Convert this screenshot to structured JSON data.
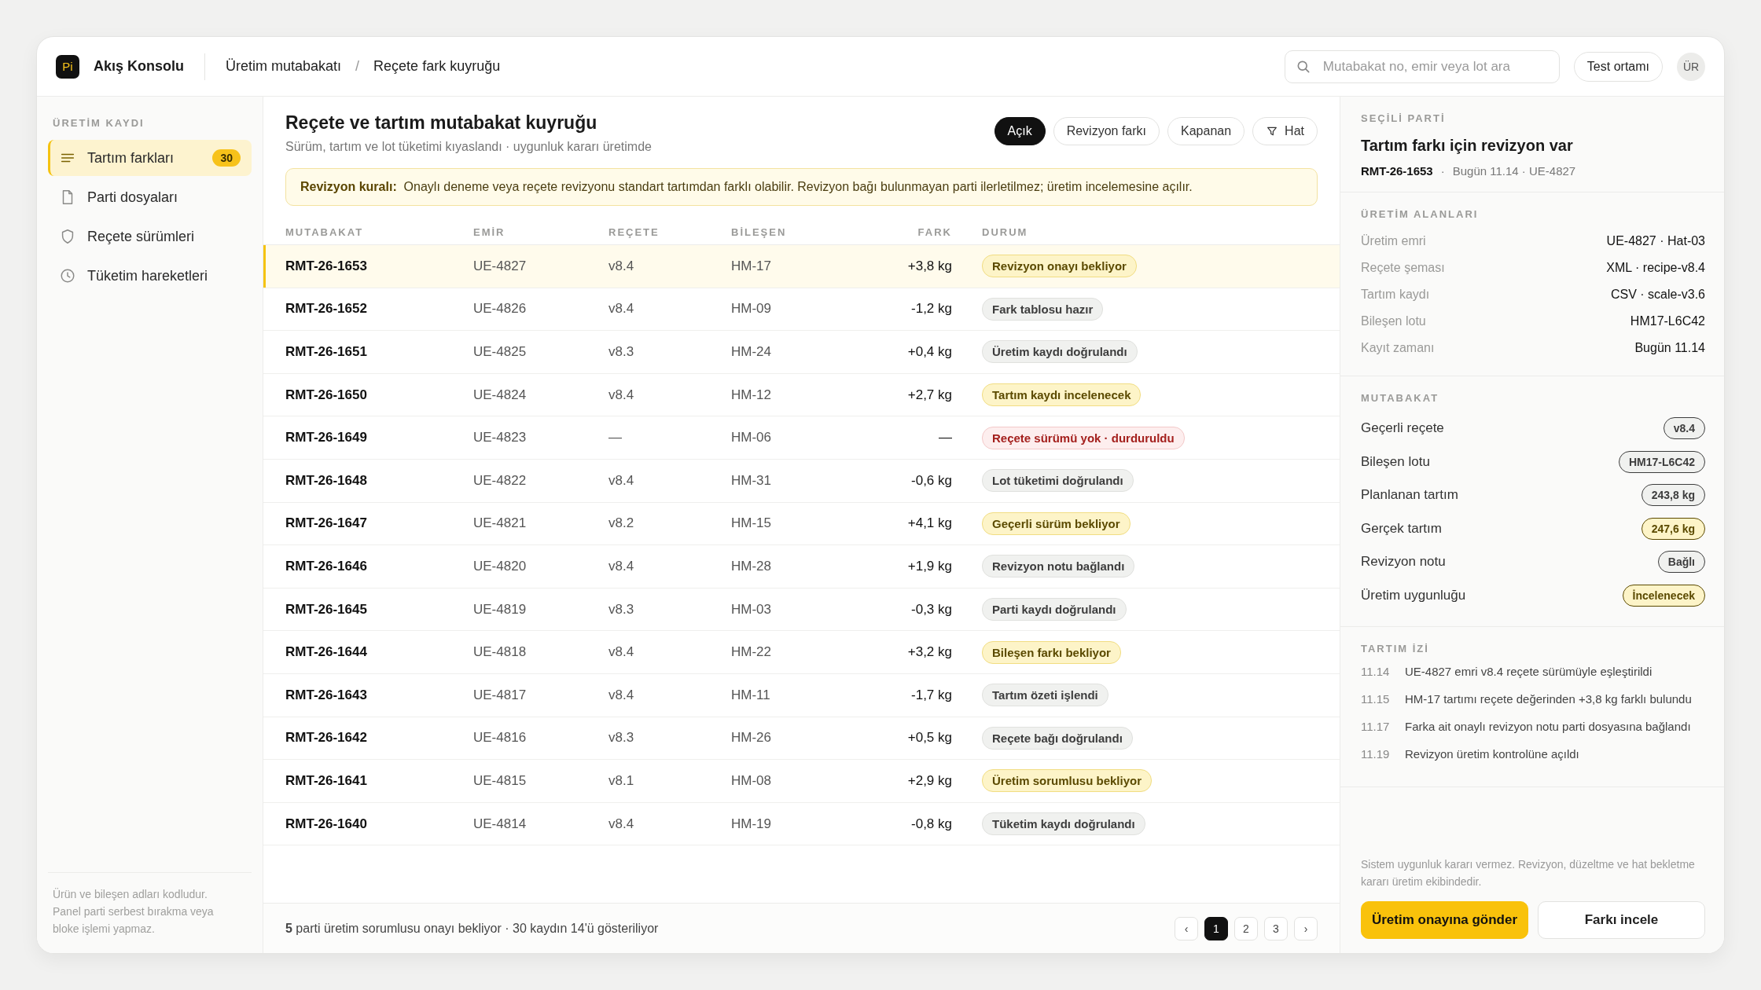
{
  "brand": {
    "logo": "Pi",
    "name": "Akış Konsolu"
  },
  "breadcrumb": {
    "items": [
      "Üretim mutabakatı",
      "Reçete fark kuyruğu"
    ],
    "separator": "/"
  },
  "search": {
    "placeholder": "Mutabakat no, emir veya lot ara"
  },
  "env_button": "Test ortamı",
  "avatar": "ÜR",
  "sidebar": {
    "heading": "ÜRETİM KAYDI",
    "items": [
      {
        "label": "Tartım farkları",
        "selected": true,
        "count": "30"
      },
      {
        "label": "Parti dosyaları",
        "selected": false
      },
      {
        "label": "Reçete sürümleri",
        "selected": false
      },
      {
        "label": "Tüketim hareketleri",
        "selected": false
      }
    ],
    "note": "Ürün ve bileşen adları kodludur. Panel parti serbest bırakma veya bloke işlemi yapmaz."
  },
  "main": {
    "title": "Reçete ve tartım mutabakat kuyruğu",
    "subtitle": "Sürüm, tartım ve lot tüketimi kıyaslandı · uygunluk kararı üretimde",
    "filters": [
      {
        "label": "Açık",
        "selected": true,
        "kind": "chip"
      },
      {
        "label": "Revizyon farkı",
        "selected": false,
        "kind": "chip"
      },
      {
        "label": "Kapanan",
        "selected": false,
        "kind": "chip"
      },
      {
        "label": "Hat",
        "selected": false,
        "kind": "filter"
      }
    ],
    "alert": "**Revizyon kuralı:**  Onaylı deneme veya reçete revizyonu standart tartımdan farklı olabilir. Revizyon bağı bulunmayan parti ilerletilmez; üretim incelemesine açılır."
  },
  "table": {
    "columns": [
      "MUTABAKAT",
      "EMİR",
      "REÇETE",
      "BİLEŞEN",
      "FARK",
      "DURUM"
    ],
    "rows": [
      {
        "id": "RMT-26-1653",
        "order": "UE-4827",
        "recipe": "v8.4",
        "component": "HM-17",
        "diff": "+3,8 kg",
        "status": "Revizyon onayı bekliyor",
        "kind": "warning",
        "selected": true
      },
      {
        "id": "RMT-26-1652",
        "order": "UE-4826",
        "recipe": "v8.4",
        "component": "HM-09",
        "diff": "-1,2 kg",
        "status": "Fark tablosu hazır",
        "kind": "neutral",
        "selected": false
      },
      {
        "id": "RMT-26-1651",
        "order": "UE-4825",
        "recipe": "v8.3",
        "component": "HM-24",
        "diff": "+0,4 kg",
        "status": "Üretim kaydı doğrulandı",
        "kind": "neutral",
        "selected": false
      },
      {
        "id": "RMT-26-1650",
        "order": "UE-4824",
        "recipe": "v8.4",
        "component": "HM-12",
        "diff": "+2,7 kg",
        "status": "Tartım kaydı incelenecek",
        "kind": "warning",
        "selected": false
      },
      {
        "id": "RMT-26-1649",
        "order": "UE-4823",
        "recipe": "—",
        "component": "HM-06",
        "diff": "—",
        "status": "Reçete sürümü yok · durduruldu",
        "kind": "error",
        "selected": false
      },
      {
        "id": "RMT-26-1648",
        "order": "UE-4822",
        "recipe": "v8.4",
        "component": "HM-31",
        "diff": "-0,6 kg",
        "status": "Lot tüketimi doğrulandı",
        "kind": "neutral",
        "selected": false
      },
      {
        "id": "RMT-26-1647",
        "order": "UE-4821",
        "recipe": "v8.2",
        "component": "HM-15",
        "diff": "+4,1 kg",
        "status": "Geçerli sürüm bekliyor",
        "kind": "warning",
        "selected": false
      },
      {
        "id": "RMT-26-1646",
        "order": "UE-4820",
        "recipe": "v8.4",
        "component": "HM-28",
        "diff": "+1,9 kg",
        "status": "Revizyon notu bağlandı",
        "kind": "neutral",
        "selected": false
      },
      {
        "id": "RMT-26-1645",
        "order": "UE-4819",
        "recipe": "v8.3",
        "component": "HM-03",
        "diff": "-0,3 kg",
        "status": "Parti kaydı doğrulandı",
        "kind": "neutral",
        "selected": false
      },
      {
        "id": "RMT-26-1644",
        "order": "UE-4818",
        "recipe": "v8.4",
        "component": "HM-22",
        "diff": "+3,2 kg",
        "status": "Bileşen farkı bekliyor",
        "kind": "warning",
        "selected": false
      },
      {
        "id": "RMT-26-1643",
        "order": "UE-4817",
        "recipe": "v8.4",
        "component": "HM-11",
        "diff": "-1,7 kg",
        "status": "Tartım özeti işlendi",
        "kind": "neutral",
        "selected": false
      },
      {
        "id": "RMT-26-1642",
        "order": "UE-4816",
        "recipe": "v8.3",
        "component": "HM-26",
        "diff": "+0,5 kg",
        "status": "Reçete bağı doğrulandı",
        "kind": "neutral",
        "selected": false
      },
      {
        "id": "RMT-26-1641",
        "order": "UE-4815",
        "recipe": "v8.1",
        "component": "HM-08",
        "diff": "+2,9 kg",
        "status": "Üretim sorumlusu bekliyor",
        "kind": "warning",
        "selected": false
      },
      {
        "id": "RMT-26-1640",
        "order": "UE-4814",
        "recipe": "v8.4",
        "component": "HM-19",
        "diff": "-0,8 kg",
        "status": "Tüketim kaydı doğrulandı",
        "kind": "neutral",
        "selected": false
      }
    ]
  },
  "footer": {
    "summary": "**5** parti üretim sorumlusu onayı bekliyor · 30 kaydın 14'ü gösteriliyor",
    "pagination": {
      "prev": "‹",
      "next": "›",
      "pages": [
        {
          "label": "1",
          "selected": true
        },
        {
          "label": "2",
          "selected": false
        },
        {
          "label": "3",
          "selected": false
        }
      ]
    }
  },
  "detail": {
    "heading": "SEÇİLİ PARTİ",
    "title": "Tartım farkı için revizyon var",
    "id": "RMT-26-1653",
    "separator": "·",
    "meta": "Bugün 11.14 · UE-4827",
    "fields_heading": "ÜRETİM ALANLARI",
    "fields": [
      {
        "label": "Üretim emri",
        "value": "UE-4827 · Hat-03"
      },
      {
        "label": "Reçete şeması",
        "value": "XML · recipe-v8.4"
      },
      {
        "label": "Tartım kaydı",
        "value": "CSV · scale-v3.6"
      },
      {
        "label": "Bileşen lotu",
        "value": "HM17-L6C42"
      },
      {
        "label": "Kayıt zamanı",
        "value": "Bugün 11.14"
      }
    ],
    "recon_heading": "MUTABAKAT",
    "recon": [
      {
        "label": "Geçerli reçete",
        "value": "v8.4",
        "kind": "neutral"
      },
      {
        "label": "Bileşen lotu",
        "value": "HM17-L6C42",
        "kind": "neutral"
      },
      {
        "label": "Planlanan tartım",
        "value": "243,8 kg",
        "kind": "neutral"
      },
      {
        "label": "Gerçek tartım",
        "value": "247,6 kg",
        "kind": "warning"
      },
      {
        "label": "Revizyon notu",
        "value": "Bağlı",
        "kind": "neutral"
      },
      {
        "label": "Üretim uygunluğu",
        "value": "İncelenecek",
        "kind": "warning"
      }
    ],
    "trace_heading": "TARTIM İZİ",
    "trace": [
      {
        "time": "11.14",
        "text": "UE-4827 emri v8.4 reçete sürümüyle eşleştirildi"
      },
      {
        "time": "11.15",
        "text": "HM-17 tartımı reçete değerinden +3,8 kg farklı bulundu"
      },
      {
        "time": "11.17",
        "text": "Farka ait onaylı revizyon notu parti dosyasına bağlandı"
      },
      {
        "time": "11.19",
        "text": "Revizyon üretim kontrolüne açıldı"
      }
    ],
    "note": "Sistem uygunluk kararı vermez. Revizyon, düzeltme ve hat bekletme kararı üretim ekibindedir.",
    "primary_button": "Üretim onayına gönder",
    "secondary_button": "Farkı incele"
  }
}
